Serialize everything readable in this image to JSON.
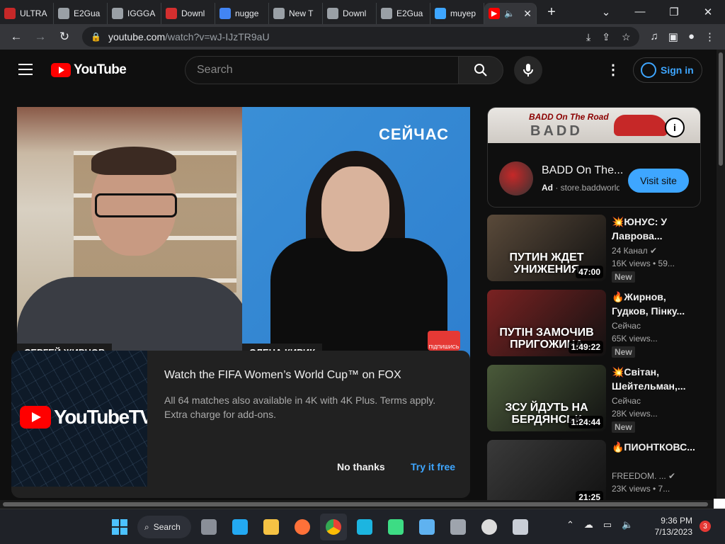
{
  "browser": {
    "tabs": [
      {
        "label": "ULTRA",
        "fav_color": "#c62828"
      },
      {
        "label": "E2Gua",
        "fav_color": "#9aa0a6"
      },
      {
        "label": "IGGGA",
        "fav_color": "#9aa0a6"
      },
      {
        "label": "Downl",
        "fav_color": "#d32f2f"
      },
      {
        "label": "nugge",
        "fav_color": "#4285f4"
      },
      {
        "label": "New T",
        "fav_color": "#9aa0a6"
      },
      {
        "label": "Downl",
        "fav_color": "#9aa0a6"
      },
      {
        "label": "E2Gua",
        "fav_color": "#9aa0a6"
      },
      {
        "label": "muyep",
        "fav_color": "#3ea6ff"
      }
    ],
    "active_tab": {
      "label": "",
      "fav_color": "#ff0000"
    },
    "url_host": "youtube.com",
    "url_path": "/watch?v=wJ-IJzTR9aU"
  },
  "youtube": {
    "logo_text": "YouTube",
    "search_placeholder": "Search",
    "signin_label": "Sign in",
    "player": {
      "left_nameplate": "СЕРГЕЙ ЖИРНОВ",
      "right_nameplate": "ОЛЕНА КИРИК",
      "brand": "СЕЙЧАС",
      "subscribe_label": "ПІДПИШИСЬ"
    },
    "promo": {
      "logo_text": "YouTubeTV",
      "title": "Watch the FIFA Women’s World Cup™ on FOX",
      "description": "All 64 matches also available in 4K with 4K Plus. Terms apply. Extra charge for add-ons.",
      "no_thanks": "No thanks",
      "try_free": "Try it free"
    },
    "ad": {
      "banner_title": "BADD On The Road",
      "banner_logo": "BADD",
      "name": "BADD On The...",
      "ad_label": "Ad",
      "domain": "store.baddworld",
      "cta": "Visit site"
    },
    "recommendations": [
      {
        "title": "💥ЮНУС: У Лаврова...",
        "channel": "24 Канал ✔",
        "views": "16K views • 59...",
        "badge": "New",
        "duration": "47:00",
        "caption": "ПУТИН ЖДЕТ УНИЖЕНИЯ",
        "thumb_color": "#5a4a3a"
      },
      {
        "title": "🔥Жирнов, Гудков, Пінку...",
        "channel": "Сейчас",
        "views": "65K views...",
        "badge": "New",
        "duration": "1:49:22",
        "caption": "ПУТІН ЗАМОЧИВ ПРИГОЖИНА",
        "thumb_color": "#7a2222"
      },
      {
        "title": "💥Світан, Шейтельман,...",
        "channel": "Сейчас",
        "views": "28K views...",
        "badge": "New",
        "duration": "1:24:44",
        "caption": "ЗСУ ЙДУТЬ НА БЕРДЯНСЬК",
        "thumb_color": "#4a5a3a"
      },
      {
        "title": "🔥ПИОНТКОВС...",
        "channel": "FREEDOM. ... ✔",
        "views": "23K views • 7...",
        "badge": "",
        "duration": "21:25",
        "caption": "",
        "thumb_color": "#3a3a3a"
      }
    ]
  },
  "taskbar": {
    "search_label": "Search",
    "time": "9:36 PM",
    "date": "7/13/2023",
    "notifications": "3"
  }
}
